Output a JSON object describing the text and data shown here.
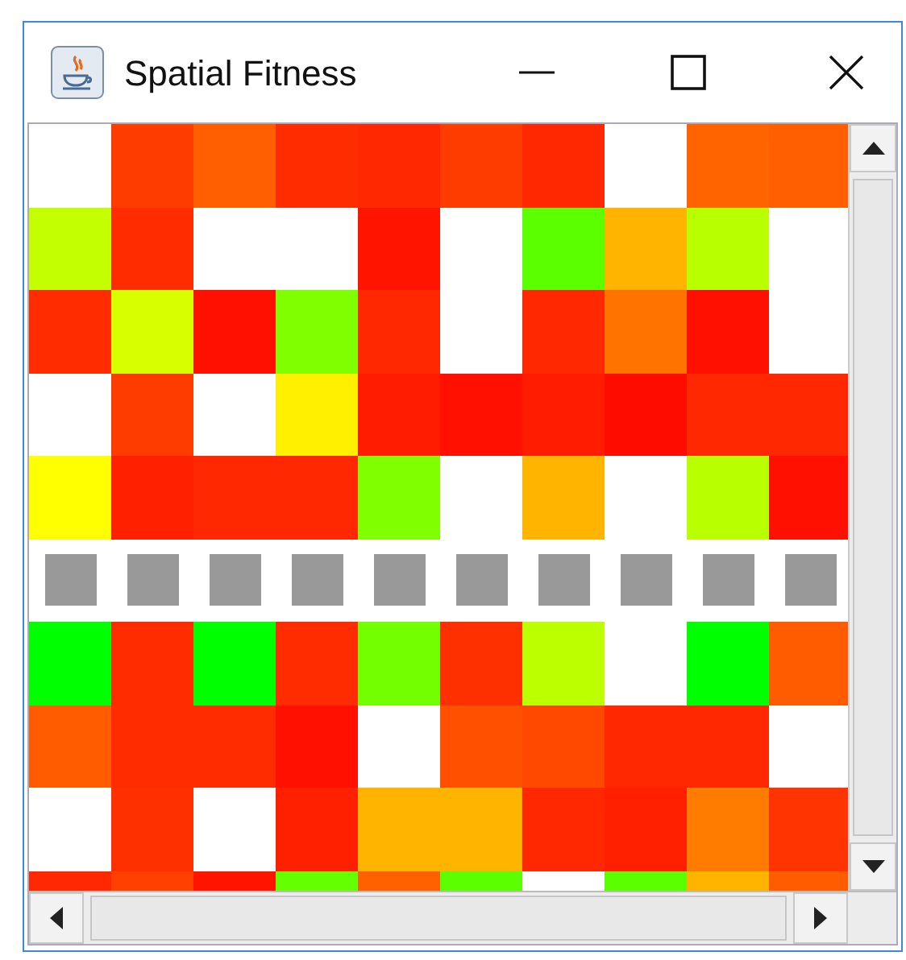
{
  "window": {
    "title": "Spatial Fitness"
  },
  "grid": {
    "rows": [
      {
        "kind": "cells",
        "cells": [
          {
            "color": "#ffffff"
          },
          {
            "color": "#ff3c00"
          },
          {
            "color": "#ff5f00"
          },
          {
            "color": "#ff2c00"
          },
          {
            "color": "#ff2800"
          },
          {
            "color": "#ff3c00"
          },
          {
            "color": "#ff2800"
          },
          {
            "color": "#ffffff"
          },
          {
            "color": "#ff6400"
          },
          {
            "color": "#ff5f00"
          }
        ]
      },
      {
        "kind": "cells",
        "cells": [
          {
            "color": "#c4ff00"
          },
          {
            "color": "#ff2c00"
          },
          {
            "color": "#ffffff"
          },
          {
            "color": "#ffffff"
          },
          {
            "color": "#ff1400"
          },
          {
            "color": "#ffffff"
          },
          {
            "color": "#5cff00"
          },
          {
            "color": "#ffb400"
          },
          {
            "color": "#b8ff00"
          },
          {
            "color": "#ffffff"
          }
        ]
      },
      {
        "kind": "cells",
        "cells": [
          {
            "color": "#ff2c00"
          },
          {
            "color": "#d8ff00"
          },
          {
            "color": "#ff1000"
          },
          {
            "color": "#80ff00"
          },
          {
            "color": "#ff2800"
          },
          {
            "color": "#ffffff"
          },
          {
            "color": "#ff2800"
          },
          {
            "color": "#ff7400"
          },
          {
            "color": "#ff1000"
          },
          {
            "color": "#ffffff"
          }
        ]
      },
      {
        "kind": "cells",
        "cells": [
          {
            "color": "#ffffff"
          },
          {
            "color": "#ff3c00"
          },
          {
            "color": "#ffffff"
          },
          {
            "color": "#fff000"
          },
          {
            "color": "#ff1c00"
          },
          {
            "color": "#ff1000"
          },
          {
            "color": "#ff1c00"
          },
          {
            "color": "#ff0c00"
          },
          {
            "color": "#ff2800"
          },
          {
            "color": "#ff2800"
          }
        ]
      },
      {
        "kind": "cells",
        "cells": [
          {
            "color": "#ffff00"
          },
          {
            "color": "#ff2000"
          },
          {
            "color": "#ff2800"
          },
          {
            "color": "#ff2800"
          },
          {
            "color": "#80ff00"
          },
          {
            "color": "#ffffff"
          },
          {
            "color": "#ffb400"
          },
          {
            "color": "#ffffff"
          },
          {
            "color": "#b8ff00"
          },
          {
            "color": "#ff1000"
          }
        ]
      },
      {
        "kind": "markers",
        "cells": [
          {
            "color": "#999999"
          },
          {
            "color": "#999999"
          },
          {
            "color": "#999999"
          },
          {
            "color": "#999999"
          },
          {
            "color": "#999999"
          },
          {
            "color": "#999999"
          },
          {
            "color": "#999999"
          },
          {
            "color": "#999999"
          },
          {
            "color": "#999999"
          },
          {
            "color": "#999999"
          }
        ]
      },
      {
        "kind": "cells",
        "cells": [
          {
            "color": "#00ff00"
          },
          {
            "color": "#ff2c00"
          },
          {
            "color": "#00ff00"
          },
          {
            "color": "#ff2c00"
          },
          {
            "color": "#74ff00"
          },
          {
            "color": "#ff3000"
          },
          {
            "color": "#bcff00"
          },
          {
            "color": "#ffffff"
          },
          {
            "color": "#00ff00"
          },
          {
            "color": "#ff5c00"
          }
        ]
      },
      {
        "kind": "cells",
        "cells": [
          {
            "color": "#ff5c00"
          },
          {
            "color": "#ff2c00"
          },
          {
            "color": "#ff2c00"
          },
          {
            "color": "#ff1000"
          },
          {
            "color": "#ffffff"
          },
          {
            "color": "#ff5000"
          },
          {
            "color": "#ff4800"
          },
          {
            "color": "#ff2800"
          },
          {
            "color": "#ff2800"
          },
          {
            "color": "#ffffff"
          }
        ]
      },
      {
        "kind": "cells",
        "cells": [
          {
            "color": "#ffffff"
          },
          {
            "color": "#ff3000"
          },
          {
            "color": "#ffffff"
          },
          {
            "color": "#ff2000"
          },
          {
            "color": "#ffb400"
          },
          {
            "color": "#ffb400"
          },
          {
            "color": "#ff2800"
          },
          {
            "color": "#ff2000"
          },
          {
            "color": "#ff7c00"
          },
          {
            "color": "#ff3400"
          }
        ]
      },
      {
        "kind": "cells",
        "cells": [
          {
            "color": "#ff2800"
          },
          {
            "color": "#ff4000"
          },
          {
            "color": "#ff1400"
          },
          {
            "color": "#64ff00"
          },
          {
            "color": "#ff6000"
          },
          {
            "color": "#5cff00"
          },
          {
            "color": "#ffffff"
          },
          {
            "color": "#5cff00"
          },
          {
            "color": "#ffb400"
          },
          {
            "color": "#ff5c00"
          }
        ]
      }
    ]
  }
}
